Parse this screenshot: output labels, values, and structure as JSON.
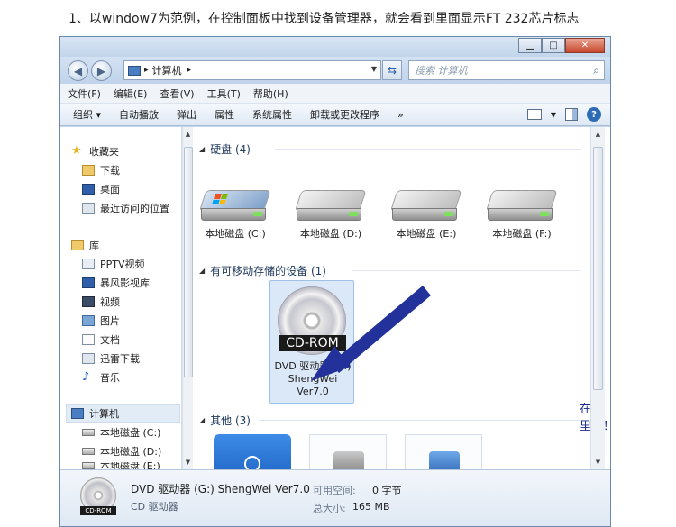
{
  "caption": "1、以window7为范例，在控制面板中找到设备管理器，就会看到里面显示FT 232芯片标志",
  "window": {
    "address": {
      "icon": "computer-small-icon",
      "path": "计算机",
      "sep": "▸"
    },
    "search_placeholder": "搜索 计算机",
    "menu": [
      "文件(F)",
      "编辑(E)",
      "查看(V)",
      "工具(T)",
      "帮助(H)"
    ],
    "toolbar": [
      "组织 ▾",
      "自动播放",
      "弹出",
      "属性",
      "系统属性",
      "卸载或更改程序",
      "»"
    ],
    "nav": {
      "favorites": {
        "label": "收藏夹",
        "items": [
          "下载",
          "桌面",
          "最近访问的位置"
        ]
      },
      "library": {
        "label": "库",
        "items": [
          "PPTV视频",
          "暴风影视库",
          "视频",
          "图片",
          "文档",
          "迅雷下载",
          "音乐"
        ]
      },
      "computer": {
        "label": "计算机",
        "items": [
          "本地磁盘 (C:)",
          "本地磁盘 (D:)",
          "本地磁盘 (E:)"
        ]
      }
    },
    "groups": {
      "hdd": "硬盘 (4)",
      "removable": "有可移动存储的设备 (1)",
      "other": "其他 (3)"
    },
    "drives": [
      "本地磁盘 (C:)",
      "本地磁盘 (D:)",
      "本地磁盘 (E:)",
      "本地磁盘 (F:)"
    ],
    "dvd": {
      "tag": "CD-ROM",
      "line1": "DVD 驱动器 (G:)",
      "line2": "ShengWei",
      "line3": "Ver7.0"
    },
    "annotation": "在这里！！！",
    "details": {
      "name": "DVD 驱动器 (G:) ShengWei Ver7.0",
      "type": "CD 驱动器",
      "tag": "CD-ROM",
      "free_label": "可用空间:",
      "free_value": "0 字节",
      "total_label": "总大小:",
      "total_value": "165 MB"
    },
    "colors": {
      "accent": "#1b2a8c",
      "arrow": "#22329a"
    }
  }
}
